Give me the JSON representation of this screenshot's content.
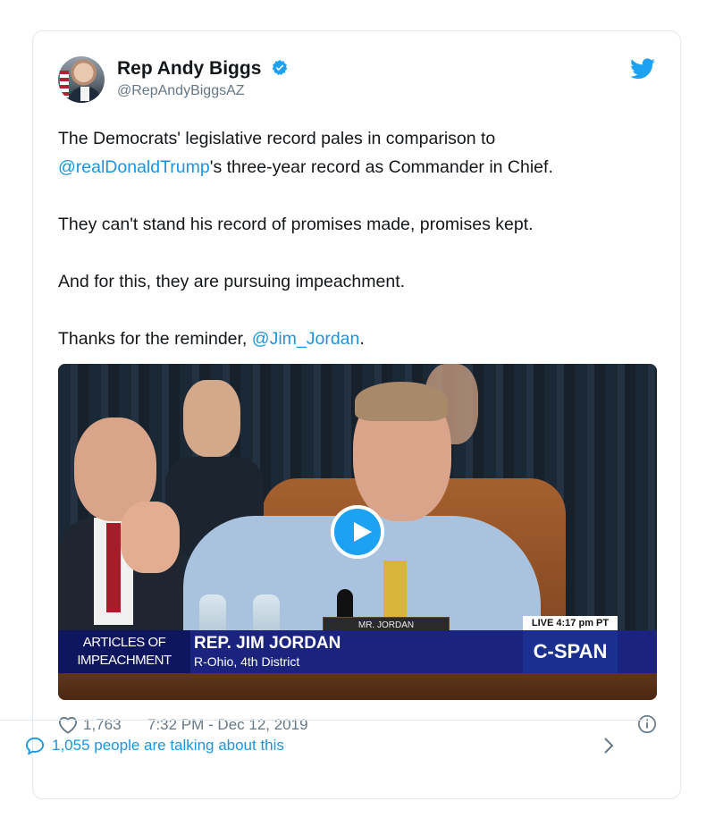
{
  "tweet": {
    "author": {
      "name": "Rep Andy Biggs",
      "handle": "@RepAndyBiggsAZ",
      "verified": true
    },
    "text": {
      "p1_a": "The Democrats' legislative record pales in comparison to",
      "p1_mention": "@realDonaldTrump",
      "p1_b": "'s three-year record as Commander in Chief.",
      "p2": "They can't stand his record of promises made, promises kept.",
      "p3": "And for this, they are pursuing impeachment.",
      "p4_a": "Thanks for the reminder, ",
      "p4_mention": "@Jim_Jordan",
      "p4_b": "."
    },
    "video": {
      "nameplate": "MR. JORDAN",
      "chyron_left_line1": "ARTICLES OF",
      "chyron_left_line2": "IMPEACHMENT",
      "chyron_name": "REP. JIM JORDAN",
      "chyron_district": "R-Ohio, 4th District",
      "live_label": "LIVE  4:17 pm PT",
      "network": "C-SPAN"
    },
    "likes": "1,763",
    "timestamp": "7:32 PM - Dec 12, 2019",
    "conversation": "1,055 people are talking about this"
  },
  "colors": {
    "accent": "#1da1f2",
    "link": "#1b95e0",
    "muted": "#657786",
    "border": "#e1e8ed"
  },
  "icons": [
    "verified-badge-icon",
    "twitter-bird-icon",
    "play-icon",
    "heart-icon",
    "info-icon",
    "speech-bubble-icon",
    "chevron-right-icon"
  ]
}
